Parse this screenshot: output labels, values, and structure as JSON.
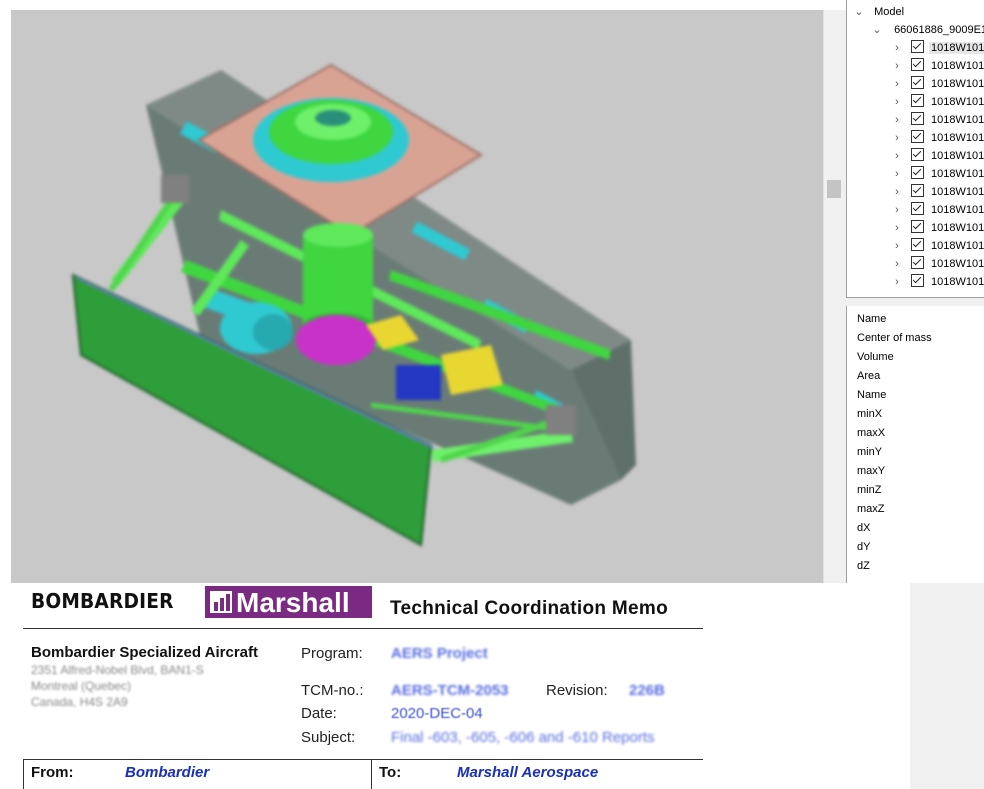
{
  "tree": {
    "root_label": "Model",
    "assembly_label": "66061886_9009E1",
    "items": [
      "1018W101",
      "1018W101",
      "1018W101",
      "1018W101",
      "1018W101",
      "1018W101",
      "1018W101",
      "1018W101",
      "1018W101",
      "1018W101",
      "1018W101",
      "1018W101",
      "1018W101",
      "1018W101"
    ]
  },
  "properties": [
    "Name",
    "Center of mass",
    "Volume",
    "Area",
    "Name",
    "minX",
    "maxX",
    "minY",
    "maxY",
    "minZ",
    "maxZ",
    "dX",
    "dY",
    "dZ"
  ],
  "memo": {
    "brand_left": "BOMBARDIER",
    "brand_right": "Marshall",
    "title": "Technical Coordination Memo",
    "company": "Bombardier Specialized Aircraft",
    "address": [
      "2351 Alfred-Nobel Blvd, BAN1-S",
      "Montreal (Quebec)",
      "Canada, H4S 2A9"
    ],
    "program_label": "Program:",
    "program_value": "AERS Project",
    "tcm_label": "TCM-no.:",
    "tcm_value": "AERS-TCM-2053",
    "revision_label": "Revision:",
    "revision_value": "226B",
    "date_label": "Date:",
    "date_value": "2020-DEC-04",
    "subject_label": "Subject:",
    "subject_value": "Final -603, -605, -606 and -610 Reports",
    "from_label": "From:",
    "from_value": "Bombardier",
    "to_label": "To:",
    "to_value": "Marshall Aerospace"
  },
  "colors": {
    "viewport_bg": "#c8c8c8",
    "part_green": "#3fd640",
    "part_cyan": "#2fc9d2",
    "part_yellow": "#e8d631",
    "part_blue": "#2438c4",
    "part_magenta": "#c832c8",
    "plate_pink": "#d9a394",
    "marshall_purple": "#7b2a84",
    "link_blue": "#1a2fb8"
  }
}
